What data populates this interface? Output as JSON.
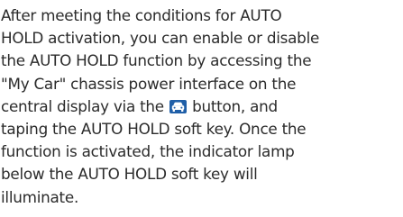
{
  "document": {
    "lines": [
      "After meeting the conditions for AUTO",
      "HOLD activation, you can enable or disable",
      "the AUTO HOLD function by accessing the",
      "\"My Car\" chassis power interface on the",
      "central display via the",
      "button, and",
      "taping the AUTO HOLD soft key. Once the",
      "function is activated, the indicator lamp",
      "below the AUTO HOLD soft key will",
      "illuminate."
    ],
    "inline_icon": "car-icon",
    "icon_color": "#1f5fa8"
  }
}
